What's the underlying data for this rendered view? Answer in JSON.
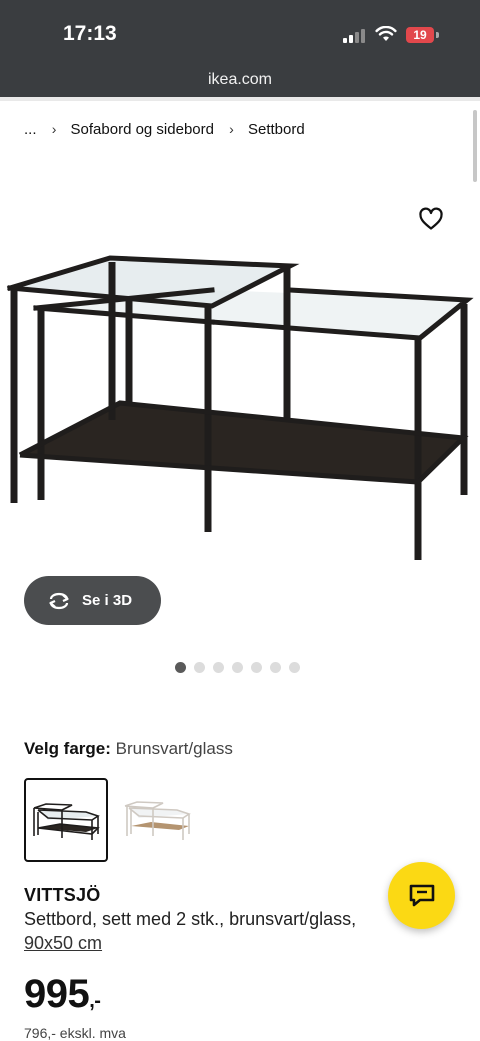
{
  "status_bar": {
    "time": "17:13",
    "battery": "19"
  },
  "browser": {
    "url": "ikea.com"
  },
  "breadcrumb": {
    "ellipsis": "...",
    "items": [
      "Sofabord og sidebord",
      "Settbord"
    ]
  },
  "product": {
    "view_3d_label": "Se i 3D",
    "gallery": {
      "count": 7,
      "active_index": 0
    },
    "color": {
      "label": "Velg farge:",
      "value": "Brunsvart/glass"
    },
    "name": "VITTSJÖ",
    "description": "Settbord, sett med 2 stk., brunsvart/glass,",
    "dimensions": "90x50 cm",
    "price": "995",
    "price_suffix": ",-",
    "price_ex_vat": "796,- ekskl. mva"
  },
  "colors": {
    "accent_yellow": "#fbd914",
    "topbar": "#3a3d40",
    "battery_red": "#e2484c"
  }
}
